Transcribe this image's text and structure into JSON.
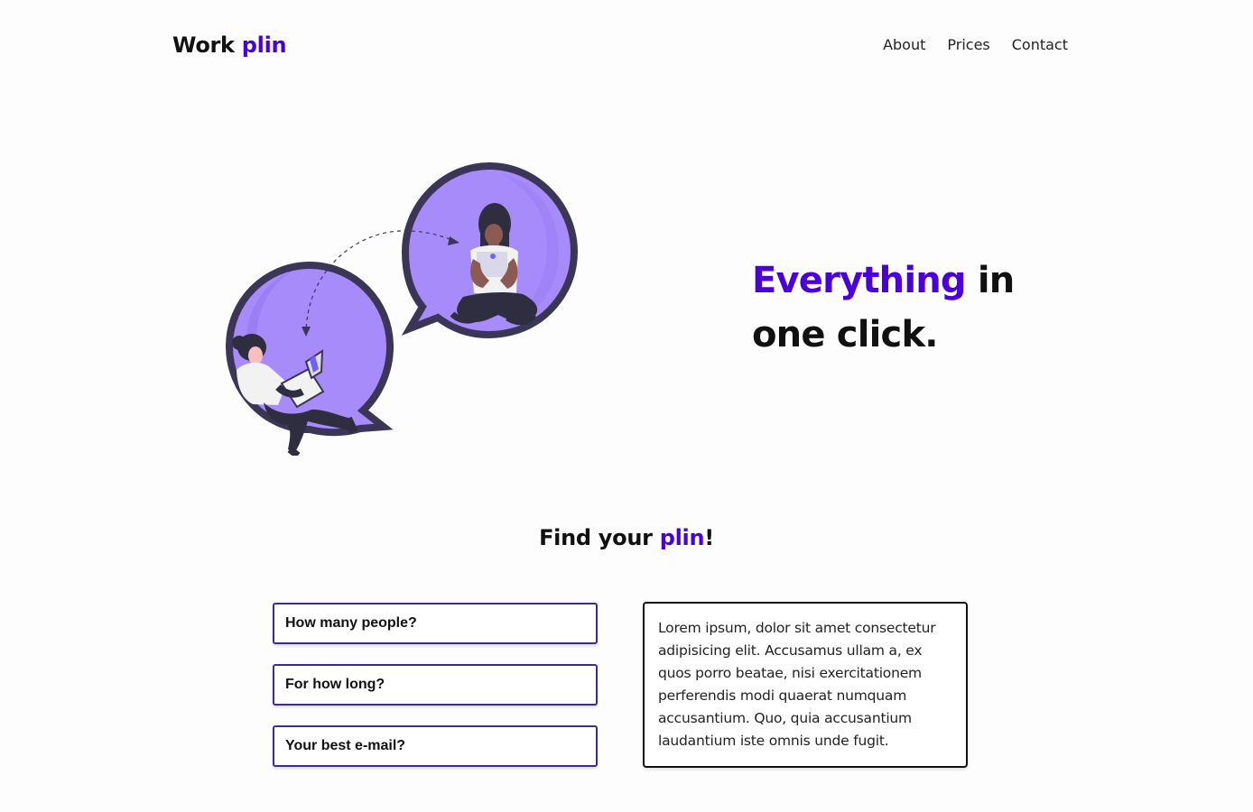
{
  "header": {
    "logo_first": "Work",
    "logo_second": "plin",
    "nav": [
      {
        "label": "About"
      },
      {
        "label": "Prices"
      },
      {
        "label": "Contact"
      }
    ]
  },
  "hero": {
    "headline_accent": "Everything",
    "headline_rest": "in",
    "headline_line2": "one click."
  },
  "find_section": {
    "title_prefix": "Find your",
    "title_accent": "plin",
    "title_suffix": "!"
  },
  "form": {
    "fields": [
      {
        "label": "How many people?"
      },
      {
        "label": "For how long?"
      },
      {
        "label": "Your best e-mail?"
      }
    ]
  },
  "info_card": {
    "text": "Lorem ipsum, dolor sit amet consectetur adipisicing elit. Accusamus ullam a, ex quos porro beatae, nisi exercitationem perferendis modi quaerat numquam accusantium. Quo, quia accusantium laudantium iste omnis unde fugit."
  },
  "colors": {
    "brand_accent": "#4a00d6",
    "purple_illustration": "#a78bfa",
    "border_dark": "#3f2a8f",
    "text_dark": "#111111"
  },
  "icons": {
    "hero_illustration": "people-chatting-illustration"
  }
}
